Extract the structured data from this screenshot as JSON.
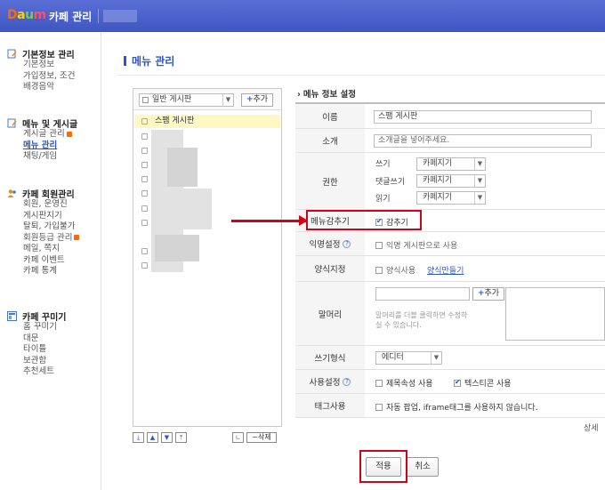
{
  "header": {
    "logo": [
      "D",
      "a",
      "u",
      "m"
    ],
    "title": "카페 관리"
  },
  "sidebar": {
    "groups": [
      {
        "title": "기본정보 관리",
        "icon": "document-edit-icon",
        "items": [
          {
            "label": "기본정보"
          },
          {
            "label": "가입정보, 조건"
          },
          {
            "label": "배경음악"
          }
        ]
      },
      {
        "title": "메뉴 및 게시글",
        "icon": "document-edit-icon",
        "items": [
          {
            "label": "게시글 관리",
            "badge": true
          },
          {
            "label": "메뉴 관리",
            "active": true
          },
          {
            "label": "채팅/게임"
          }
        ]
      },
      {
        "title": "카페 회원관리",
        "icon": "users-icon",
        "items": [
          {
            "label": "회원, 운영진"
          },
          {
            "label": "게시판지기"
          },
          {
            "label": "탈퇴, 가입불가"
          },
          {
            "label": "회원등급 관리",
            "badge": true
          },
          {
            "label": "메일, 쪽지"
          },
          {
            "label": "카페 이벤트"
          },
          {
            "label": "카페 통계"
          }
        ]
      },
      {
        "title": "카페 꾸미기",
        "icon": "layout-icon",
        "items": [
          {
            "label": "홈 꾸미기"
          },
          {
            "label": "대문"
          },
          {
            "label": "타이틀"
          },
          {
            "label": "보관함"
          },
          {
            "label": "추천세트"
          }
        ]
      }
    ]
  },
  "main": {
    "page_title": "메뉴 관리",
    "board_select": "일반 게시판",
    "add_label": "추가",
    "add_label_plus": "+",
    "selected_board": "스팸 게시판",
    "delete_label": "삭제",
    "delete_prefix": "−",
    "settings_title": "메뉴 정보 설정",
    "rows": {
      "name": {
        "label": "이름",
        "value": "스팸 게시판"
      },
      "intro": {
        "label": "소개",
        "value": "소개글을 넣어주세요."
      },
      "permission": {
        "label": "권한",
        "write": {
          "label": "쓰기",
          "value": "카페지기"
        },
        "comment": {
          "label": "댓글쓰기",
          "value": "카페지기"
        },
        "read": {
          "label": "읽기",
          "value": "카페지기"
        }
      },
      "hide_menu": {
        "label": "메뉴감추기",
        "option": "감추기",
        "checked": true
      },
      "anonymous": {
        "label": "익명설정",
        "option": "익명 게시판으로 사용",
        "checked": false
      },
      "template": {
        "label": "양식지정",
        "option": "양식사용",
        "link": "양식만들기",
        "checked": false
      },
      "header_text": {
        "label": "말머리",
        "add": "추가",
        "hint_line1": "말머리를 더블 클릭하면 수정하",
        "hint_line2": "실 수 있습니다."
      },
      "write_format": {
        "label": "쓰기형식",
        "value": "에디터"
      },
      "usage": {
        "label": "사용설정",
        "opt1": "제목속성 사용",
        "opt1_checked": false,
        "opt2": "텍스티콘 사용",
        "opt2_checked": true
      },
      "tag": {
        "label": "태그사용",
        "option": "자동 팝업, iframe태그를 사용하지 않습니다.",
        "checked": false
      }
    },
    "more": "상세",
    "apply": "적용",
    "cancel": "취소"
  },
  "colors": {
    "header": "#4a60cb",
    "accent": "#2c57c9",
    "highlight": "#d0021b",
    "selected_row": "#fff8c4"
  }
}
